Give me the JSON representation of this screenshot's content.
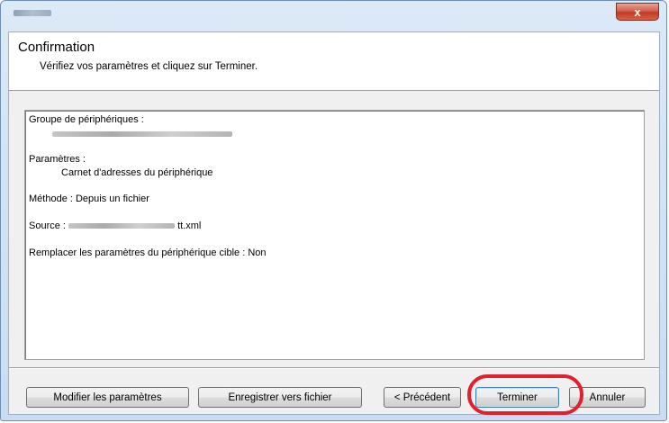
{
  "window": {
    "close_label": "x"
  },
  "header": {
    "title": "Confirmation",
    "subtitle": "Vérifiez vos paramètres et cliquez sur Terminer."
  },
  "summary": {
    "group_label": "Groupe de périphériques :",
    "params_label": "Paramètres :",
    "params_value": "Carnet d'adresses du périphérique",
    "method": "Méthode : Depuis un fichier",
    "source_label": "Source :",
    "source_suffix": "tt.xml",
    "replace": "Remplacer les paramètres du périphérique cible : Non"
  },
  "buttons": {
    "modify": "Modifier les paramètres",
    "save": "Enregistrer vers fichier",
    "previous": "< Précédent",
    "finish": "Terminer",
    "cancel": "Annuler"
  },
  "colors": {
    "highlight_ring": "#e0202c",
    "close_button": "#c23a22"
  }
}
